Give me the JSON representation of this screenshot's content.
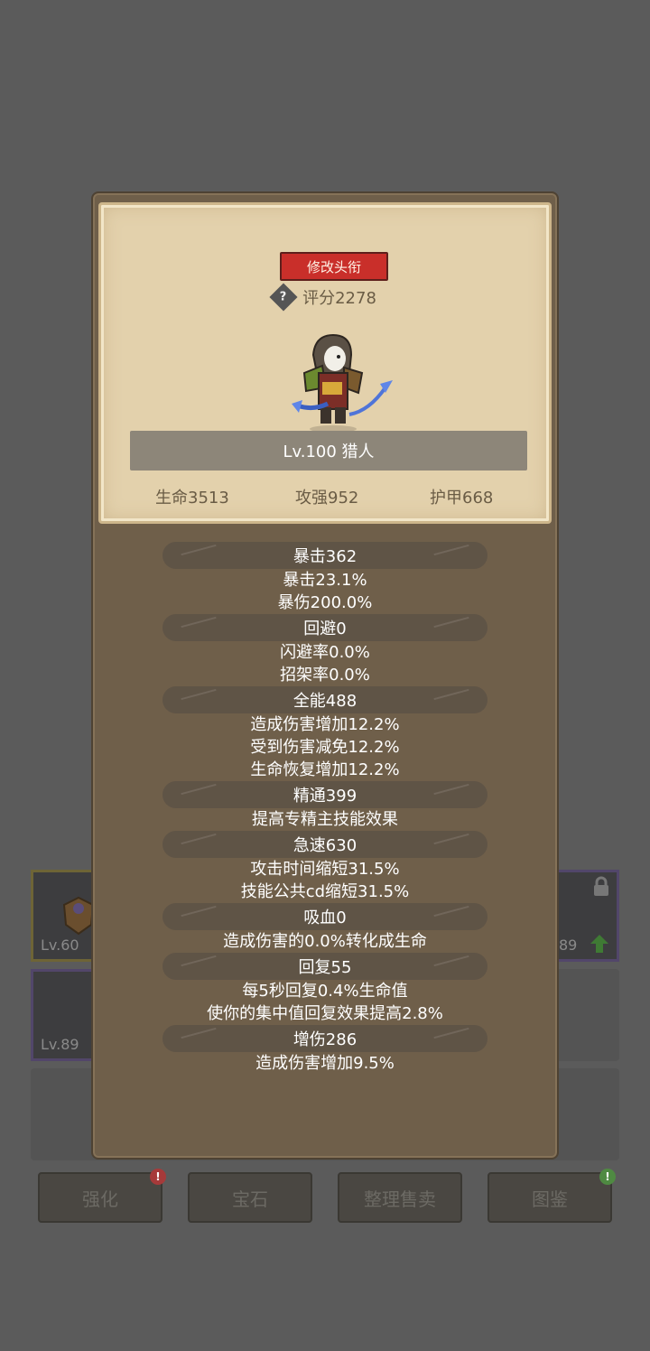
{
  "background": {
    "slots": [
      {
        "level": "Lv.60"
      },
      {
        "level": "Lv.89"
      },
      {
        "level": "89"
      }
    ],
    "buttons": [
      {
        "label": "强化",
        "badge": "!"
      },
      {
        "label": "宝石",
        "badge": ""
      },
      {
        "label": "整理售卖",
        "badge": ""
      },
      {
        "label": "图鉴",
        "badge": "!"
      }
    ]
  },
  "profile": {
    "title_button": "修改头衔",
    "help_glyph": "?",
    "score": "评分2278",
    "name": "Lv.100 猎人",
    "hp": "生命3513",
    "attack": "攻强952",
    "armor": "护甲668"
  },
  "stats": [
    {
      "header": "暴击362",
      "lines": [
        "暴击23.1%",
        "暴伤200.0%"
      ]
    },
    {
      "header": "回避0",
      "lines": [
        "闪避率0.0%",
        "招架率0.0%"
      ]
    },
    {
      "header": "全能488",
      "lines": [
        "造成伤害增加12.2%",
        "受到伤害减免12.2%",
        "生命恢复增加12.2%"
      ]
    },
    {
      "header": "精通399",
      "lines": [
        "提高专精主技能效果"
      ]
    },
    {
      "header": "急速630",
      "lines": [
        "攻击时间缩短31.5%",
        "技能公共cd缩短31.5%"
      ]
    },
    {
      "header": "吸血0",
      "lines": [
        "造成伤害的0.0%转化成生命"
      ]
    },
    {
      "header": "回复55",
      "lines": [
        "每5秒回复0.4%生命值",
        "使你的集中值回复效果提高2.8%"
      ]
    },
    {
      "header": "增伤286",
      "lines": [
        "造成伤害增加9.5%"
      ]
    }
  ]
}
